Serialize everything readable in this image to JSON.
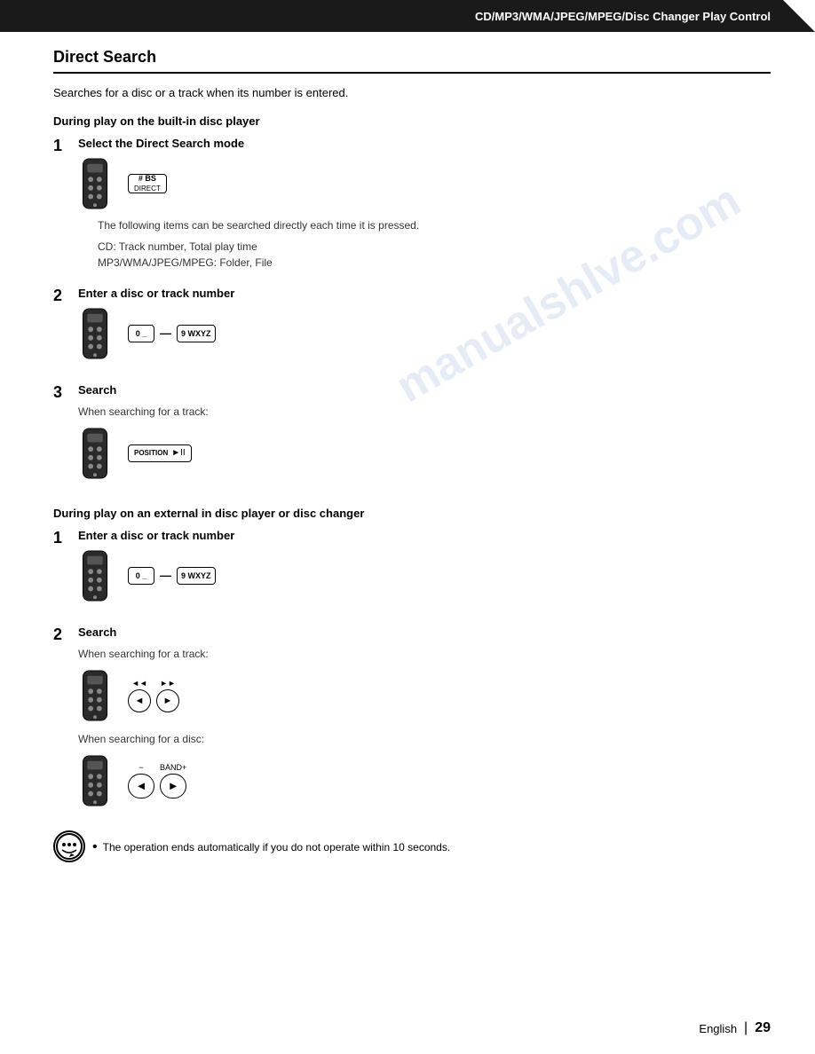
{
  "header": {
    "title": "CD/MP3/WMA/JPEG/MPEG/Disc Changer Play Control"
  },
  "page": {
    "section_title": "Direct Search",
    "intro": "Searches for a disc or a track when its number is entered.",
    "subsection1": {
      "label": "During play on the built-in disc player",
      "steps": [
        {
          "number": "1",
          "label": "Select the Direct Search mode",
          "info_lines": [
            "The following items can be searched directly each time it is pressed.",
            "CD: Track number, Total play time",
            "MP3/WMA/JPEG/MPEG: Folder, File"
          ],
          "button_label": "# BS\nDIRECT"
        },
        {
          "number": "2",
          "label": "Enter a disc or track number",
          "button_start": "0  _",
          "button_end": "9 WXYZ"
        },
        {
          "number": "3",
          "label": "Search",
          "sub_label": "When searching for a track:",
          "button_label": "POSITION ►II"
        }
      ]
    },
    "subsection2": {
      "label": "During play on an external in disc player or disc changer",
      "steps": [
        {
          "number": "1",
          "label": "Enter a disc or track number",
          "button_start": "0  _",
          "button_end": "9 WXYZ"
        },
        {
          "number": "2",
          "label": "Search",
          "sub_label_track": "When searching for a track:",
          "sub_label_disc": "When searching for a disc:"
        }
      ]
    },
    "note": {
      "bullet": "The operation ends automatically if you do not operate within 10 seconds."
    }
  },
  "footer": {
    "language": "English",
    "divider": "|",
    "page_number": "29"
  },
  "watermark": {
    "line1": "manualshlve.com"
  }
}
